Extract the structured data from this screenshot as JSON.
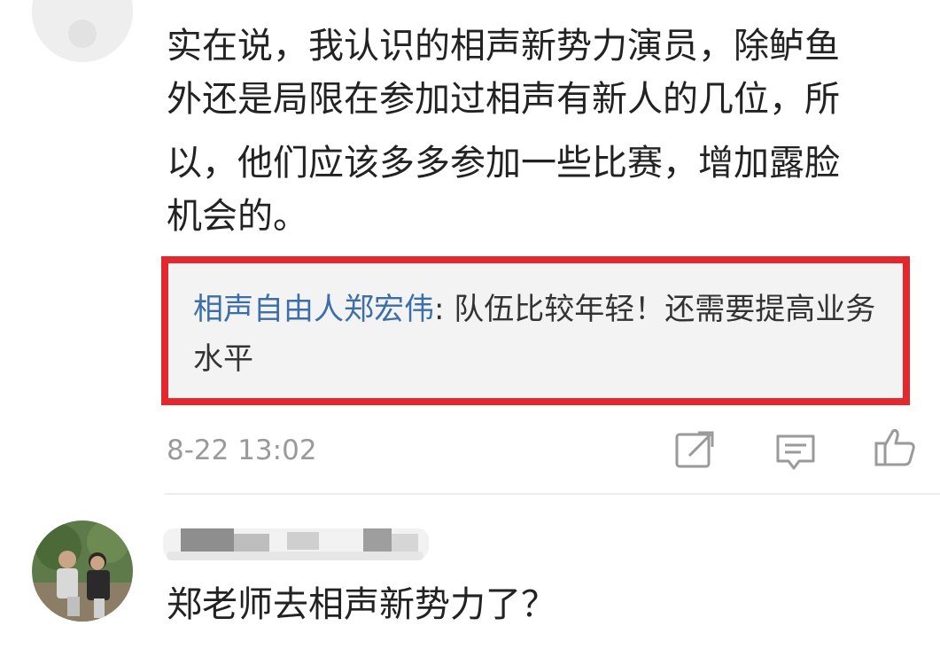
{
  "comments": [
    {
      "text_lines": [
        "实在说，我认识的相声新势力演员，除鲈鱼",
        "外还是局限在参加过相声有新人的几位，所",
        "以，他们应该多多参加一些比赛，增加露脸",
        "机会的。"
      ],
      "reply": {
        "author": "相声自由人郑宏伟",
        "separator": ": ",
        "text": "队伍比较年轻！还需要提高业务水平"
      },
      "time": "8-22 13:02",
      "actions": [
        "share-icon",
        "comment-icon",
        "like-icon"
      ]
    },
    {
      "text": "郑老师去相声新势力了？"
    }
  ],
  "colors": {
    "highlight_border": "#e3272d",
    "reply_author": "#3c6ea8",
    "meta_text": "#9a9a9a",
    "reply_bg": "#f3f3f3"
  }
}
